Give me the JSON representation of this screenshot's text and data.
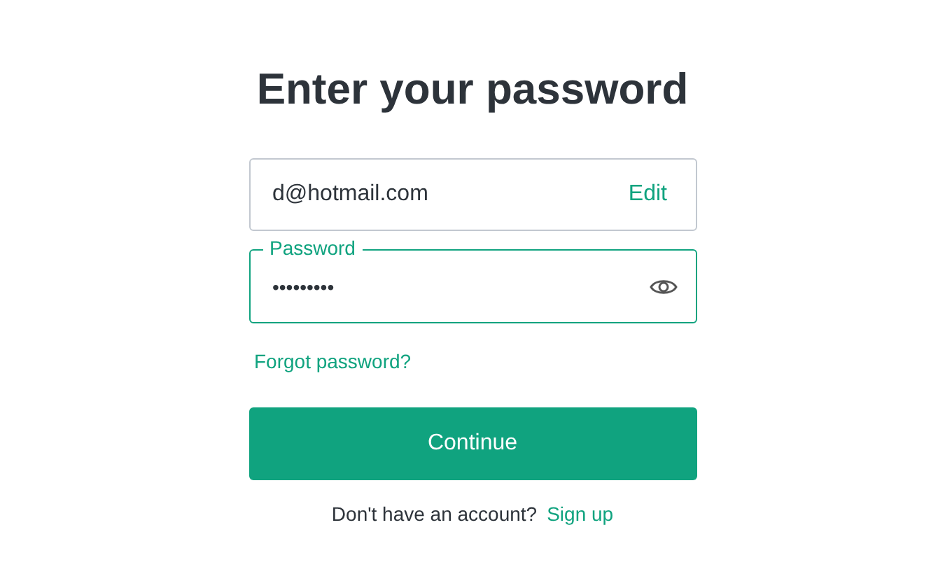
{
  "title": "Enter your password",
  "email": {
    "value": "d@hotmail.com",
    "action": "Edit"
  },
  "password": {
    "label": "Password",
    "value": "•••••••••",
    "focused": true
  },
  "forgot_link": "Forgot password?",
  "continue_button": "Continue",
  "signup": {
    "text": "Don't have an account?",
    "link": "Sign up"
  }
}
